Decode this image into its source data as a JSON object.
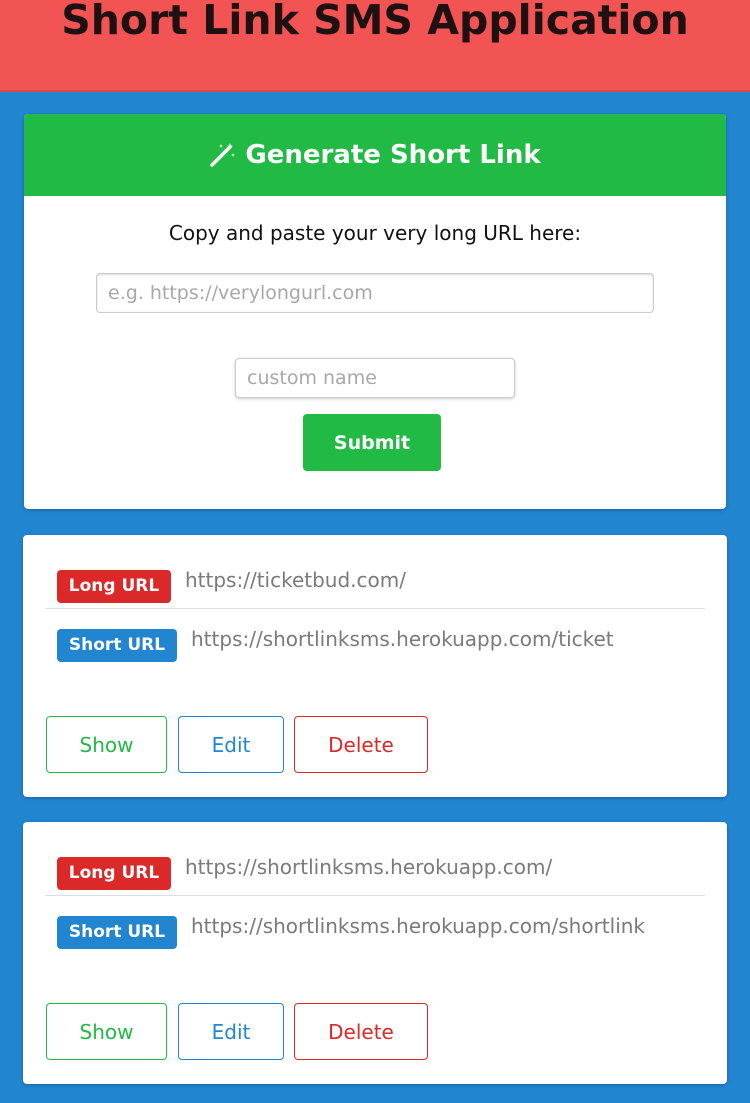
{
  "app": {
    "title": "Short Link SMS Application"
  },
  "generator": {
    "heading": "Generate Short Link",
    "heading_icon": "magic-wand-icon",
    "instruction": "Copy and paste your very long URL here:",
    "url_placeholder": "e.g. https://verylongurl.com",
    "url_value": "",
    "custom_placeholder": "custom name",
    "custom_value": "",
    "submit_label": "Submit"
  },
  "links": [
    {
      "long_label": "Long URL",
      "long_url": "https://ticketbud.com/",
      "short_label": "Short URL",
      "short_url": "https://shortlinksms.herokuapp.com/ticket",
      "show_label": "Show",
      "edit_label": "Edit",
      "delete_label": "Delete"
    },
    {
      "long_label": "Long URL",
      "long_url": "https://shortlinksms.herokuapp.com/",
      "short_label": "Short URL",
      "short_url": "https://shortlinksms.herokuapp.com/shortlink",
      "show_label": "Show",
      "edit_label": "Edit",
      "delete_label": "Delete"
    }
  ],
  "colors": {
    "header_bg": "#f25454",
    "page_bg": "#2185d0",
    "green": "#21ba45",
    "red": "#db2828",
    "blue": "#2185d0"
  }
}
